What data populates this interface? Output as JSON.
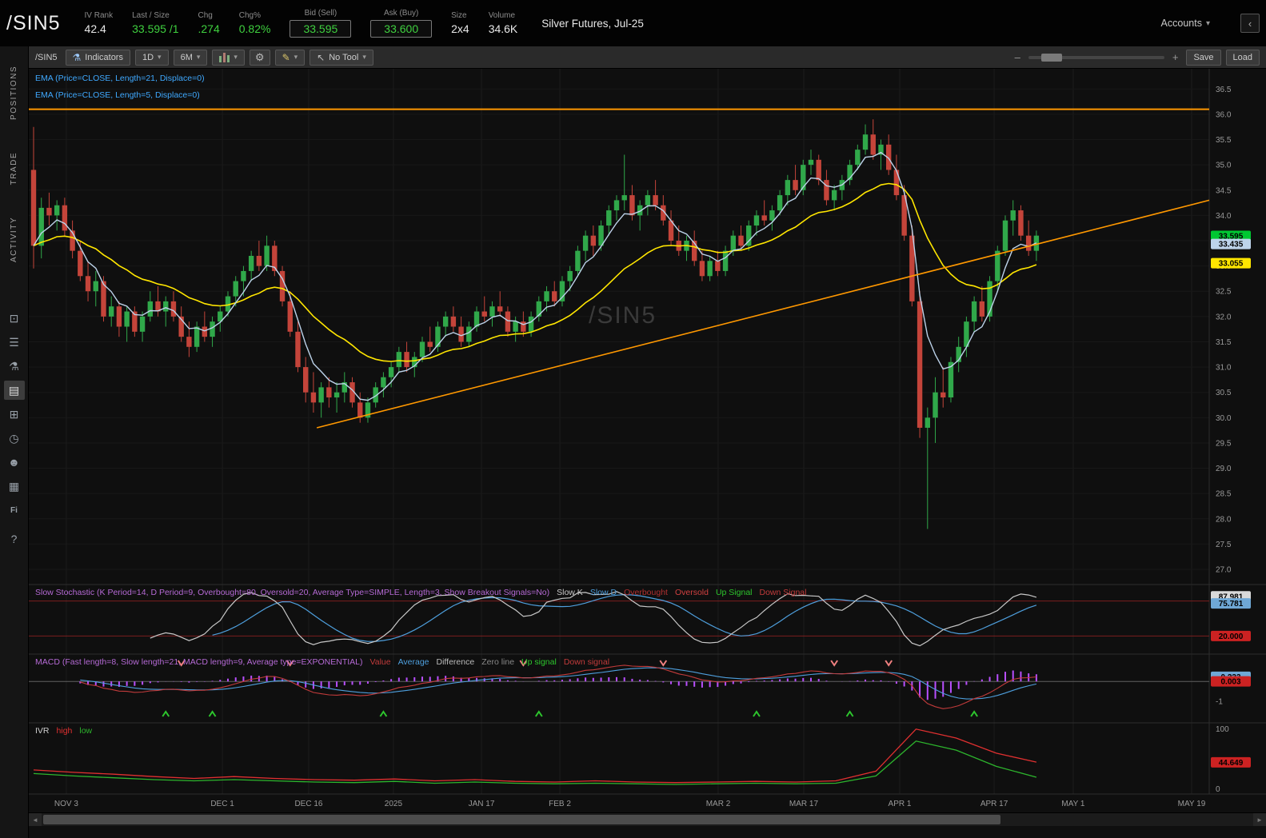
{
  "colors": {
    "up": "#30a84a",
    "down": "#c4443a",
    "green_text": "#3fd03f",
    "accent_orange": "#ff9800",
    "ema_fast": "#bdd3ea",
    "ema_slow": "#ffe600",
    "ema_label": "#3fa9ff",
    "axis_text": "#9a9a9a",
    "grid": "#1d1d1d",
    "macd_hist": "#b94fff",
    "macd_value": "#c23b3b",
    "stoch_k": "#c8c8c8",
    "stoch_d": "#4e9fdd",
    "title_purple": "#b56ad5",
    "signal_up": "#2dc52d",
    "signal_down": "#f08080",
    "ivr_high": "#e03030",
    "ivr_low": "#2db52d",
    "badge_green": "#00c832",
    "badge_red": "#cc2222",
    "badge_blue": "#6fa8d6",
    "badge_gray": "#d9d9d9",
    "badge_yellow": "#ffe600",
    "badge_lightblue": "#bdd3ea"
  },
  "topbar": {
    "symbol": "/SIN5",
    "fields": [
      {
        "label": "IV Rank",
        "value": "42.4"
      },
      {
        "label": "Last / Size",
        "value": "33.595 /1"
      },
      {
        "label": "Chg",
        "value": ".274"
      },
      {
        "label": "Chg%",
        "value": "0.82%"
      },
      {
        "label": "Bid (Sell)",
        "value": "33.595"
      },
      {
        "label": "Ask (Buy)",
        "value": "33.600"
      },
      {
        "label": "Size",
        "value": "2x4"
      },
      {
        "label": "Volume",
        "value": "34.6K"
      }
    ],
    "description": "Silver Futures, Jul-25",
    "accounts_label": "Accounts"
  },
  "sidebar": {
    "tabs": [
      "POSITIONS",
      "TRADE",
      "ACTIVITY"
    ],
    "icons": [
      {
        "name": "monitor-icon",
        "glyph": "⊡"
      },
      {
        "name": "watchlist-icon",
        "glyph": "☰"
      },
      {
        "name": "analyze-icon",
        "glyph": "⚗"
      },
      {
        "name": "charts-icon",
        "glyph": "▤"
      },
      {
        "name": "scan-icon",
        "glyph": "⊞"
      },
      {
        "name": "history-icon",
        "glyph": "◷"
      },
      {
        "name": "community-icon",
        "glyph": "☻"
      },
      {
        "name": "calendar-icon",
        "glyph": "▦"
      },
      {
        "name": "financials-icon",
        "glyph": "Fi"
      },
      {
        "name": "help-icon",
        "glyph": "?"
      }
    ]
  },
  "toolbar": {
    "symbol": "/SIN5",
    "indicators_label": "Indicators",
    "timeframe": "1D",
    "range": "6M",
    "no_tool_label": "No Tool",
    "save_label": "Save",
    "load_label": "Load"
  },
  "ui": {
    "caret": "▾",
    "minus": "–",
    "plus": "+",
    "scroll_left": "◄",
    "scroll_right": "►",
    "collapse": "‹",
    "flask": "⚗",
    "gear": "⚙",
    "pencil": "✎",
    "cursor": "↖"
  },
  "chart_data": {
    "type": "candlestick",
    "symbol": "/SIN5",
    "title": "Silver Futures, Jul-25, Daily, 6 Months",
    "ylim": [
      27.0,
      36.5
    ],
    "ytick_step": 0.5,
    "watermark": "/SIN5",
    "overlays": {
      "ema21_label": "EMA (Price=CLOSE, Length=21, Displace=0)",
      "ema5_label": "EMA (Price=CLOSE, Length=5, Displace=0)",
      "horizontal_line_price": 36.1,
      "trendline": {
        "x1": 0.244,
        "p1": 29.8,
        "x2": 1.0,
        "p2": 34.3
      }
    },
    "badges": [
      {
        "v": 33.595,
        "text": "33.595",
        "bg": "badge_green"
      },
      {
        "v": 33.435,
        "text": "33.435",
        "bg": "badge_lightblue"
      },
      {
        "v": 33.055,
        "text": "33.055",
        "bg": "badge_yellow"
      }
    ],
    "time_axis": [
      {
        "label": "NOV 3",
        "x": 0.0318
      },
      {
        "label": "DEC 1",
        "x": 0.164
      },
      {
        "label": "DEC 16",
        "x": 0.2371
      },
      {
        "label": "2025",
        "x": 0.3089
      },
      {
        "label": "JAN 17",
        "x": 0.3835
      },
      {
        "label": "FEB 2",
        "x": 0.4499
      },
      {
        "label": "MAR 2",
        "x": 0.584
      },
      {
        "label": "MAR 17",
        "x": 0.6565
      },
      {
        "label": "APR 1",
        "x": 0.7378
      },
      {
        "label": "APR 17",
        "x": 0.8178
      },
      {
        "label": "MAY 1",
        "x": 0.8848
      },
      {
        "label": "MAY 19",
        "x": 0.9851
      }
    ],
    "candles": [
      [
        34.9,
        35.75,
        32.95,
        33.4
      ],
      [
        33.4,
        34.35,
        33.15,
        34.15
      ],
      [
        34.15,
        34.45,
        33.8,
        34.0
      ],
      [
        34.0,
        34.3,
        33.7,
        34.2
      ],
      [
        34.2,
        34.35,
        33.6,
        33.7
      ],
      [
        33.7,
        33.9,
        33.15,
        33.3
      ],
      [
        33.3,
        33.5,
        32.7,
        32.8
      ],
      [
        32.8,
        33.1,
        32.3,
        32.5
      ],
      [
        32.5,
        32.9,
        32.2,
        32.7
      ],
      [
        32.7,
        32.8,
        31.9,
        32.0
      ],
      [
        32.0,
        32.4,
        31.8,
        32.2
      ],
      [
        32.2,
        32.3,
        31.6,
        31.8
      ],
      [
        31.8,
        32.2,
        31.5,
        32.1
      ],
      [
        32.1,
        32.2,
        31.6,
        31.7
      ],
      [
        31.7,
        32.1,
        31.5,
        32.0
      ],
      [
        32.0,
        32.5,
        31.9,
        32.3
      ],
      [
        32.3,
        32.6,
        32.0,
        32.1
      ],
      [
        32.1,
        32.4,
        31.8,
        32.3
      ],
      [
        32.3,
        32.5,
        31.9,
        32.0
      ],
      [
        32.0,
        32.2,
        31.5,
        31.6
      ],
      [
        31.6,
        31.9,
        31.2,
        31.4
      ],
      [
        31.4,
        31.9,
        31.3,
        31.8
      ],
      [
        31.8,
        32.1,
        31.5,
        31.6
      ],
      [
        31.6,
        32.0,
        31.4,
        31.9
      ],
      [
        31.9,
        32.2,
        31.7,
        32.1
      ],
      [
        32.1,
        32.5,
        32.0,
        32.4
      ],
      [
        32.4,
        32.8,
        32.2,
        32.7
      ],
      [
        32.7,
        33.0,
        32.4,
        32.9
      ],
      [
        32.9,
        33.3,
        32.7,
        33.2
      ],
      [
        33.2,
        33.5,
        32.9,
        33.0
      ],
      [
        33.0,
        33.6,
        32.9,
        33.4
      ],
      [
        33.4,
        33.5,
        32.8,
        32.9
      ],
      [
        32.9,
        33.0,
        32.2,
        32.3
      ],
      [
        32.3,
        32.5,
        31.6,
        31.7
      ],
      [
        31.7,
        31.9,
        30.9,
        31.0
      ],
      [
        31.0,
        31.2,
        30.3,
        30.5
      ],
      [
        30.5,
        30.9,
        30.1,
        30.3
      ],
      [
        30.3,
        30.7,
        30.0,
        30.6
      ],
      [
        30.6,
        30.8,
        30.2,
        30.4
      ],
      [
        30.4,
        30.7,
        30.1,
        30.5
      ],
      [
        30.5,
        30.9,
        30.3,
        30.7
      ],
      [
        30.7,
        30.8,
        30.2,
        30.3
      ],
      [
        30.3,
        30.5,
        29.9,
        30.0
      ],
      [
        30.0,
        30.4,
        29.9,
        30.3
      ],
      [
        30.3,
        30.7,
        30.2,
        30.6
      ],
      [
        30.6,
        30.9,
        30.4,
        30.8
      ],
      [
        30.8,
        31.1,
        30.6,
        31.0
      ],
      [
        31.0,
        31.4,
        30.9,
        31.3
      ],
      [
        31.3,
        31.5,
        30.9,
        31.0
      ],
      [
        31.0,
        31.3,
        30.8,
        31.2
      ],
      [
        31.2,
        31.6,
        31.1,
        31.5
      ],
      [
        31.5,
        31.8,
        31.3,
        31.4
      ],
      [
        31.4,
        31.9,
        31.3,
        31.8
      ],
      [
        31.8,
        32.1,
        31.6,
        32.0
      ],
      [
        32.0,
        32.2,
        31.7,
        31.8
      ],
      [
        31.8,
        32.0,
        31.4,
        31.5
      ],
      [
        31.5,
        31.9,
        31.4,
        31.8
      ],
      [
        31.8,
        32.2,
        31.7,
        32.1
      ],
      [
        32.1,
        32.4,
        31.9,
        32.0
      ],
      [
        32.0,
        32.3,
        31.8,
        32.2
      ],
      [
        32.2,
        32.5,
        32.0,
        32.1
      ],
      [
        32.1,
        32.2,
        31.6,
        31.7
      ],
      [
        31.7,
        32.0,
        31.5,
        31.9
      ],
      [
        31.9,
        32.1,
        31.6,
        31.7
      ],
      [
        31.7,
        32.1,
        31.6,
        32.0
      ],
      [
        32.0,
        32.4,
        31.9,
        32.3
      ],
      [
        32.3,
        32.6,
        32.1,
        32.5
      ],
      [
        32.5,
        32.7,
        32.2,
        32.3
      ],
      [
        32.3,
        32.8,
        32.2,
        32.7
      ],
      [
        32.7,
        33.0,
        32.5,
        32.9
      ],
      [
        32.9,
        33.4,
        32.8,
        33.3
      ],
      [
        33.3,
        33.7,
        33.1,
        33.6
      ],
      [
        33.6,
        33.8,
        33.2,
        33.4
      ],
      [
        33.4,
        33.9,
        33.3,
        33.8
      ],
      [
        33.8,
        34.2,
        33.6,
        34.1
      ],
      [
        34.1,
        34.4,
        33.9,
        34.3
      ],
      [
        34.3,
        35.2,
        34.1,
        34.4
      ],
      [
        34.4,
        34.6,
        33.9,
        34.0
      ],
      [
        34.0,
        34.3,
        33.7,
        34.2
      ],
      [
        34.2,
        34.5,
        34.0,
        34.4
      ],
      [
        34.4,
        34.7,
        34.1,
        34.2
      ],
      [
        34.2,
        34.4,
        33.8,
        33.9
      ],
      [
        33.9,
        34.1,
        33.4,
        33.5
      ],
      [
        33.5,
        33.8,
        33.2,
        33.3
      ],
      [
        33.3,
        33.6,
        33.1,
        33.5
      ],
      [
        33.5,
        33.7,
        33.0,
        33.1
      ],
      [
        33.1,
        33.3,
        32.7,
        32.8
      ],
      [
        32.8,
        33.2,
        32.7,
        33.1
      ],
      [
        33.1,
        33.3,
        32.8,
        32.9
      ],
      [
        32.9,
        33.4,
        32.8,
        33.3
      ],
      [
        33.3,
        33.7,
        33.2,
        33.6
      ],
      [
        33.6,
        33.8,
        33.3,
        33.4
      ],
      [
        33.4,
        33.9,
        33.3,
        33.8
      ],
      [
        33.8,
        34.1,
        33.6,
        34.0
      ],
      [
        34.0,
        34.3,
        33.8,
        33.9
      ],
      [
        33.9,
        34.2,
        33.7,
        34.1
      ],
      [
        34.1,
        34.5,
        34.0,
        34.4
      ],
      [
        34.4,
        34.8,
        34.2,
        34.7
      ],
      [
        34.7,
        35.0,
        34.4,
        34.5
      ],
      [
        34.5,
        35.1,
        34.4,
        35.0
      ],
      [
        35.0,
        35.3,
        34.8,
        35.1
      ],
      [
        35.1,
        35.2,
        34.6,
        34.7
      ],
      [
        34.7,
        34.9,
        34.2,
        34.3
      ],
      [
        34.3,
        34.6,
        34.1,
        34.5
      ],
      [
        34.5,
        34.8,
        34.3,
        34.7
      ],
      [
        34.7,
        35.1,
        34.6,
        35.0
      ],
      [
        35.0,
        35.4,
        34.9,
        35.3
      ],
      [
        35.3,
        35.8,
        35.2,
        35.6
      ],
      [
        35.6,
        35.9,
        35.1,
        35.2
      ],
      [
        35.2,
        35.5,
        34.9,
        35.4
      ],
      [
        35.4,
        35.6,
        34.8,
        34.9
      ],
      [
        34.9,
        35.2,
        34.3,
        34.4
      ],
      [
        34.4,
        34.6,
        33.5,
        33.6
      ],
      [
        33.6,
        33.8,
        32.2,
        32.3
      ],
      [
        32.3,
        32.5,
        29.6,
        29.8
      ],
      [
        29.8,
        30.2,
        27.8,
        30.0
      ],
      [
        30.0,
        30.8,
        29.5,
        30.5
      ],
      [
        30.5,
        31.0,
        30.2,
        30.4
      ],
      [
        30.4,
        31.2,
        30.3,
        31.1
      ],
      [
        31.1,
        31.6,
        30.9,
        31.4
      ],
      [
        31.4,
        32.0,
        31.2,
        31.9
      ],
      [
        31.9,
        32.4,
        31.7,
        32.3
      ],
      [
        32.3,
        32.6,
        31.9,
        32.0
      ],
      [
        32.0,
        32.8,
        31.9,
        32.7
      ],
      [
        32.7,
        33.4,
        32.5,
        33.3
      ],
      [
        33.3,
        34.0,
        33.2,
        33.9
      ],
      [
        33.9,
        34.3,
        33.6,
        34.1
      ],
      [
        34.1,
        34.2,
        33.5,
        33.6
      ],
      [
        33.6,
        33.9,
        33.2,
        33.3
      ],
      [
        33.3,
        33.7,
        33.1,
        33.6
      ]
    ]
  },
  "stoch": {
    "title": "Slow Stochastic (K Period=14, D Period=9, Overbought=80, Oversold=20, Average Type=SIMPLE, Length=3, Show Breakout Signals=No)",
    "overbought": 80,
    "oversold": 20,
    "legend": [
      [
        "Slow K",
        "#c8c8c8"
      ],
      [
        "Slow D",
        "#4e9fdd"
      ],
      [
        "Overbought",
        "#b03030"
      ],
      [
        "Oversold",
        "#d04040"
      ],
      [
        "Up Signal",
        "#2dc52d"
      ],
      [
        "Down Signal",
        "#c23b3b"
      ]
    ],
    "badges": [
      {
        "v": 87.981,
        "text": "87.981",
        "bg": "badge_gray"
      },
      {
        "v": 75.781,
        "text": "75.781",
        "bg": "badge_blue"
      },
      {
        "v": 20.0,
        "text": "20.000",
        "bg": "badge_red"
      }
    ]
  },
  "macd": {
    "title": "MACD (Fast length=8, Slow length=21, MACD length=9, Average type=EXPONENTIAL)",
    "range": [
      -1.9,
      1.2
    ],
    "legend": [
      [
        "Value",
        "#c23b3b"
      ],
      [
        "Average",
        "#4e9fdd"
      ],
      [
        "Difference",
        "#bbbbbb"
      ],
      [
        "Zero line",
        "#888888"
      ],
      [
        "Up signal",
        "#2dc52d"
      ],
      [
        "Down signal",
        "#c23b3b"
      ]
    ],
    "ticks": [
      {
        "v": -1,
        "label": "-1"
      }
    ],
    "badges": [
      {
        "v": 0.233,
        "text": "0.233",
        "bg": "badge_blue"
      },
      {
        "v": 0.003,
        "text": "0.003",
        "bg": "badge_red"
      }
    ]
  },
  "ivr": {
    "title": "IVR",
    "legend": [
      [
        "high",
        "#e03030"
      ],
      [
        "low",
        "#2db52d"
      ]
    ],
    "scale": [
      0,
      105
    ],
    "high_series": [
      32,
      28,
      25,
      21,
      18,
      21,
      18,
      16,
      15,
      17,
      14,
      16,
      13,
      12,
      14,
      12,
      11,
      12,
      13,
      12,
      14,
      30,
      100,
      85,
      60,
      45
    ],
    "low_series": [
      26,
      22,
      19,
      16,
      14,
      16,
      14,
      12,
      11,
      13,
      10,
      12,
      10,
      9,
      10,
      9,
      8,
      9,
      10,
      9,
      10,
      22,
      80,
      65,
      38,
      20
    ],
    "ticks": [
      {
        "v": 100,
        "label": "100"
      },
      {
        "v": 0,
        "label": "0"
      }
    ],
    "badges": [
      {
        "v": 44.649,
        "text": "44.649",
        "bg": "badge_red"
      }
    ]
  }
}
